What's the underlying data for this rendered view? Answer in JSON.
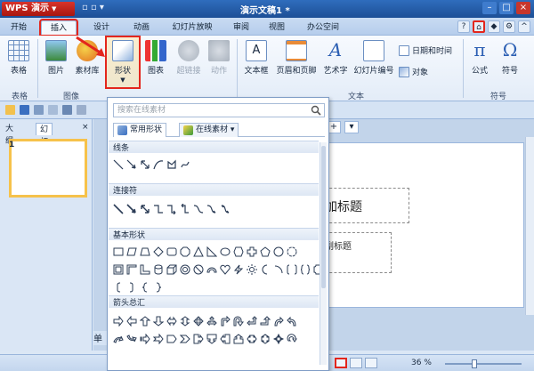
{
  "app": {
    "name": "WPS 演示",
    "document_title": "演示文稿1 *"
  },
  "tabs": [
    {
      "label": "开始",
      "active": false
    },
    {
      "label": "插入",
      "active": true
    },
    {
      "label": "设计",
      "active": false
    },
    {
      "label": "动画",
      "active": false
    },
    {
      "label": "幻灯片放映",
      "active": false
    },
    {
      "label": "审阅",
      "active": false
    },
    {
      "label": "视图",
      "active": false
    },
    {
      "label": "办公空间",
      "active": false
    }
  ],
  "ribbon": {
    "table": "表格",
    "picture": "图片",
    "material": "素材库",
    "shape": "形状",
    "chart": "图表",
    "hyperlink": "超链接",
    "action": "动作",
    "textbox": "文本框",
    "header_footer": "页眉和页脚",
    "wordart": "艺术字",
    "slide_number": "幻灯片编号",
    "datetime": "日期和时间",
    "object": "对象",
    "formula": "公式",
    "symbol": "符号",
    "groups": {
      "table": "表格",
      "image": "图像",
      "text": "文本",
      "symbol": "符号"
    }
  },
  "left_panel": {
    "tab_outline": "大纲",
    "tab_slides": "幻灯片",
    "slide_number": "1"
  },
  "slide": {
    "title_fragment": "加标题",
    "subtitle_fragment": "副标题"
  },
  "bottom_fragment": "单",
  "status": {
    "zoom": "36 %"
  },
  "shapes_dropdown": {
    "search_placeholder": "搜索在线素材",
    "tab_common": "常用形状",
    "tab_online": "在线素材",
    "sections": {
      "lines": "线条",
      "connectors": "连接符",
      "basic": "基本形状",
      "arrows": "箭头总汇"
    }
  },
  "colors": {
    "highlight_red": "#e3261d",
    "title_blue": "#1d4f96",
    "accent_orange": "#f6c24b"
  }
}
